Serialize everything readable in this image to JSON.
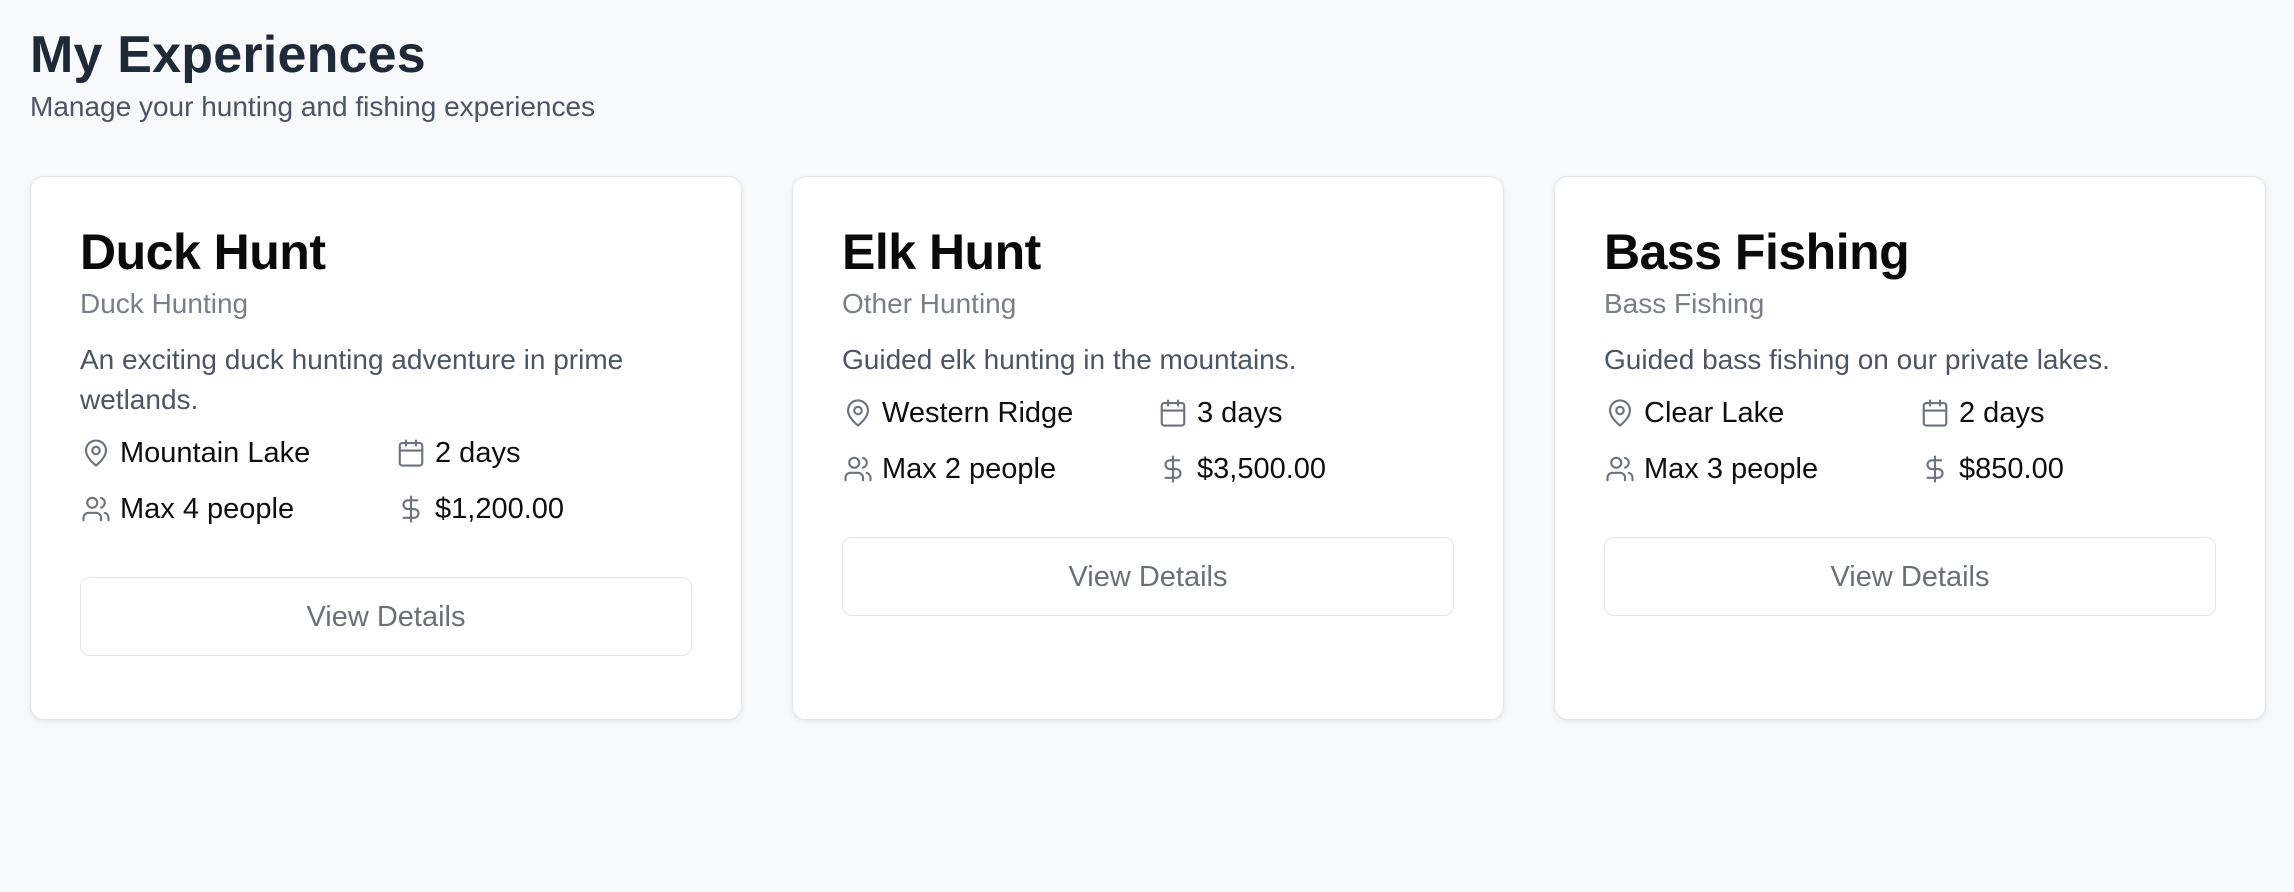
{
  "header": {
    "title": "My Experiences",
    "subtitle": "Manage your hunting and fishing experiences"
  },
  "cards": [
    {
      "title": "Duck Hunt",
      "category": "Duck Hunting",
      "description": "An exciting duck hunting adventure in prime wetlands.",
      "location": "Mountain Lake",
      "duration": "2 days",
      "capacity": "Max 4 people",
      "price": "$1,200.00",
      "button_label": "View Details"
    },
    {
      "title": "Elk Hunt",
      "category": "Other Hunting",
      "description": "Guided elk hunting in the mountains.",
      "location": "Western Ridge",
      "duration": "3 days",
      "capacity": "Max 2 people",
      "price": "$3,500.00",
      "button_label": "View Details"
    },
    {
      "title": "Bass Fishing",
      "category": "Bass Fishing",
      "description": "Guided bass fishing on our private lakes.",
      "location": "Clear Lake",
      "duration": "2 days",
      "capacity": "Max 3 people",
      "price": "$850.00",
      "button_label": "View Details"
    }
  ],
  "icons": {
    "location": "map-pin-icon",
    "duration": "calendar-icon",
    "capacity": "users-icon",
    "price": "dollar-icon"
  },
  "colors": {
    "background": "#f8f9fb",
    "card_background": "#ffffff",
    "border": "#e3e5e9",
    "title": "#1f2937",
    "muted_text": "#7a7f87",
    "icon": "#6b7280"
  }
}
